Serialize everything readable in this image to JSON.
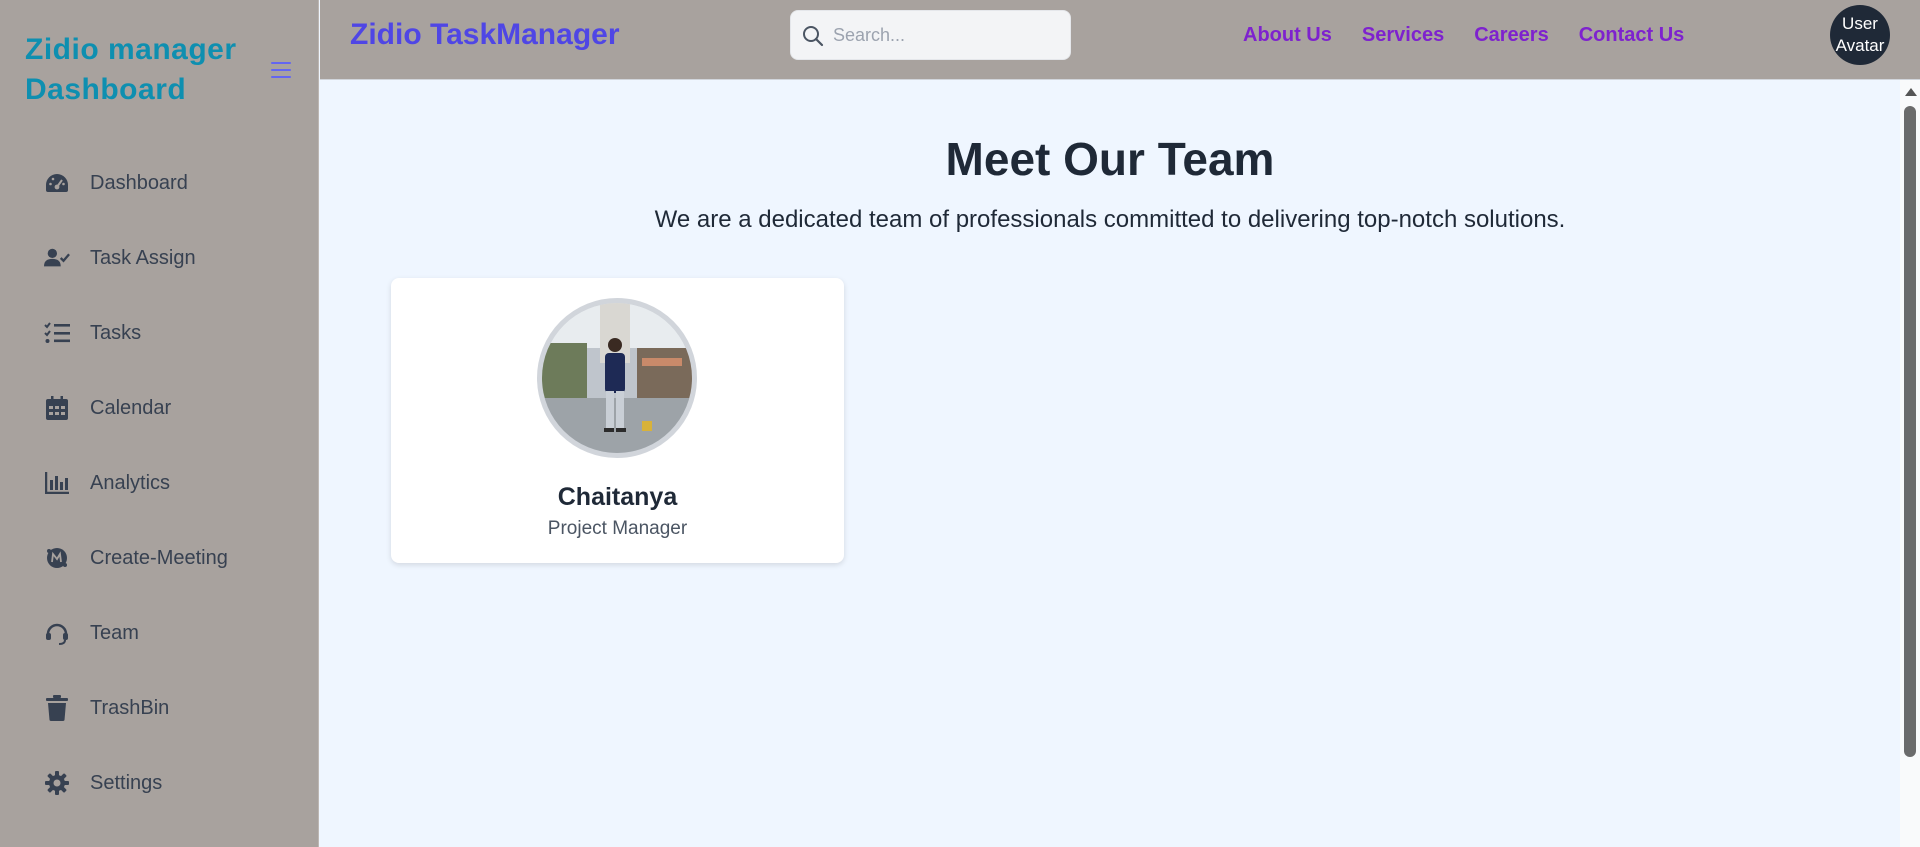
{
  "sidebar": {
    "brand_line1": "Zidio manager",
    "brand_line2": "Dashboard",
    "items": [
      {
        "label": "Dashboard",
        "icon": "gauge-icon"
      },
      {
        "label": "Task Assign",
        "icon": "user-check-icon"
      },
      {
        "label": "Tasks",
        "icon": "list-check-icon"
      },
      {
        "label": "Calendar",
        "icon": "calendar-icon"
      },
      {
        "label": "Analytics",
        "icon": "bar-chart-icon"
      },
      {
        "label": "Create-Meeting",
        "icon": "meetup-icon"
      },
      {
        "label": "Team",
        "icon": "headset-icon"
      },
      {
        "label": "TrashBin",
        "icon": "trash-icon"
      },
      {
        "label": "Settings",
        "icon": "gear-icon"
      }
    ]
  },
  "header": {
    "title": "Zidio TaskManager",
    "search_placeholder": "Search...",
    "links": [
      "About Us",
      "Services",
      "Careers",
      "Contact Us"
    ],
    "avatar_alt": "User Avatar"
  },
  "main": {
    "title": "Meet Our Team",
    "subtitle": "We are a dedicated team of professionals committed to delivering top-notch solutions.",
    "members": [
      {
        "name": "Chaitanya",
        "role": "Project Manager"
      }
    ]
  },
  "colors": {
    "sidebar_bg": "#a8a29e",
    "brand": "#0e8fb0",
    "header_title": "#4f46e5",
    "link": "#7e22ce",
    "main_bg": "#eff6ff"
  }
}
